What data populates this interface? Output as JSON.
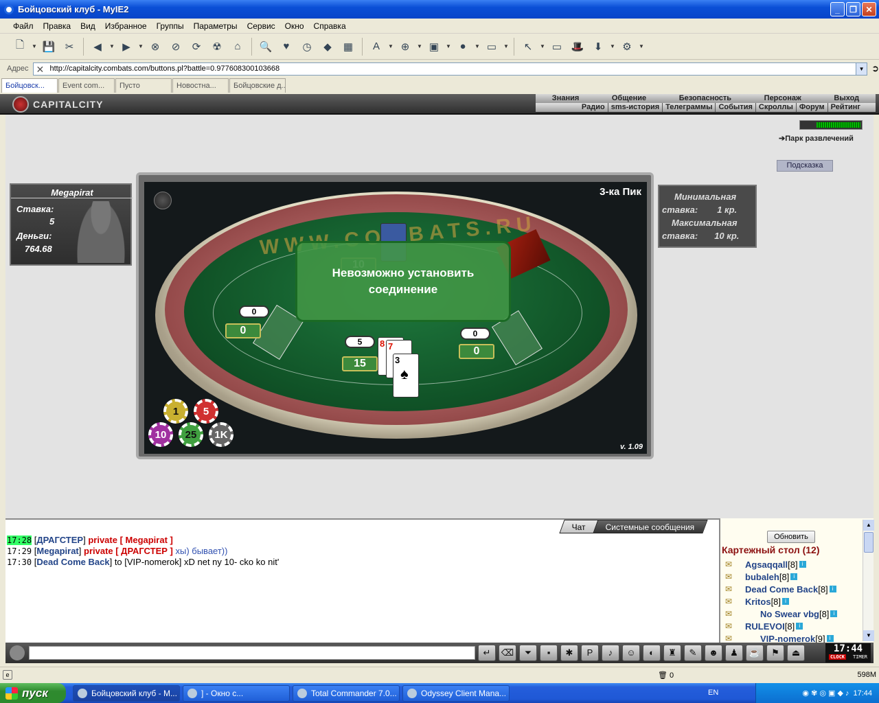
{
  "window": {
    "title": "Бойцовский клуб - MyIE2"
  },
  "menu": [
    "Файл",
    "Правка",
    "Вид",
    "Избранное",
    "Группы",
    "Параметры",
    "Сервис",
    "Окно",
    "Справка"
  ],
  "address": {
    "label": "Адрес",
    "url": "http://capitalcity.combats.com/buttons.pl?battle=0.977608300103668"
  },
  "tabs": [
    "Бойцовск...",
    "Event com...",
    "Пусто",
    "Новостна...",
    "Бойцовские д..."
  ],
  "header": {
    "logo": "CAPITALCITY",
    "nav_top": [
      "Знания",
      "Общение",
      "Безопасность",
      "Персонаж",
      "Выход"
    ],
    "nav_bottom": [
      "Радио",
      "sms-история",
      "Телеграммы",
      "События",
      "Скроллы",
      "Форум",
      "Рейтинг"
    ]
  },
  "side": {
    "park": "Парк развлечений",
    "hint": "Подсказка"
  },
  "player": {
    "name": "Megapirat",
    "bet_label": "Ставка:",
    "bet": "5",
    "money_label": "Деньги:",
    "money": "764.68"
  },
  "limits": {
    "min_label": "Минимальная",
    "min_stake_label": "ставка:",
    "min_value": "1 кр.",
    "max_label": "Максимальная",
    "max_stake_label": "ставка:",
    "max_value": "10 кр."
  },
  "table": {
    "name": "3-ка Пик",
    "version": "v. 1.09",
    "watermark": "WWW.COMBATS.RU",
    "seat_left": {
      "bet": "0",
      "score": "0"
    },
    "seat_center": {
      "bet": "5",
      "score": "15"
    },
    "seat_right": {
      "bet": "0",
      "score": "0"
    },
    "dealer_score": "10",
    "cards": [
      {
        "rank": "8",
        "suit": "♥"
      },
      {
        "rank": "7",
        "suit": "♥"
      },
      {
        "rank": "3",
        "suit": "♠"
      }
    ],
    "chips": [
      "1",
      "5",
      "10",
      "25",
      "1K"
    ],
    "error": "Невозможно установить соединение"
  },
  "chat": {
    "tabs": [
      "Чат",
      "Системные сообщения"
    ],
    "messages": [
      {
        "time": "17:28",
        "from": "ДРАГСТЕР",
        "private": "private [ Megapirat ]",
        "to": "",
        "text": ""
      },
      {
        "time": "17:29",
        "from": "Megapirat",
        "private": "private [ ДРАГСТЕР ]",
        "to": "",
        "text": "хы) бывает))"
      },
      {
        "time": "17:30",
        "from": "Dead Come Back",
        "private": "",
        "to": "to [VIP-nomerok]",
        "text": "xD net ny 10- cko ko nit'"
      }
    ]
  },
  "users": {
    "refresh": "Обновить",
    "title": "Картежный стол (12)",
    "list": [
      {
        "name": "Agsaqqall",
        "level": "[8]"
      },
      {
        "name": "bubaleh",
        "level": "[8]"
      },
      {
        "name": "Dead Come Back",
        "level": "[8]"
      },
      {
        "name": "Kritos",
        "level": "[8]"
      },
      {
        "name": "No Swear vbg",
        "level": "[8]"
      },
      {
        "name": "RULEVOI",
        "level": "[8]"
      },
      {
        "name": "VIP-nomerok",
        "level": "[9]"
      }
    ]
  },
  "clock": {
    "time": "17:44",
    "clock_label": "CLOCK",
    "timer_label": "TIMER"
  },
  "status": {
    "count": "0",
    "memory": "598M"
  },
  "taskbar": {
    "start": "пуск",
    "tasks": [
      "Бойцовский клуб - M...",
      "] - Окно с...",
      "Total Commander 7.0...",
      "Odyssey Client Mana..."
    ],
    "lang": "EN",
    "time": "17:44"
  }
}
